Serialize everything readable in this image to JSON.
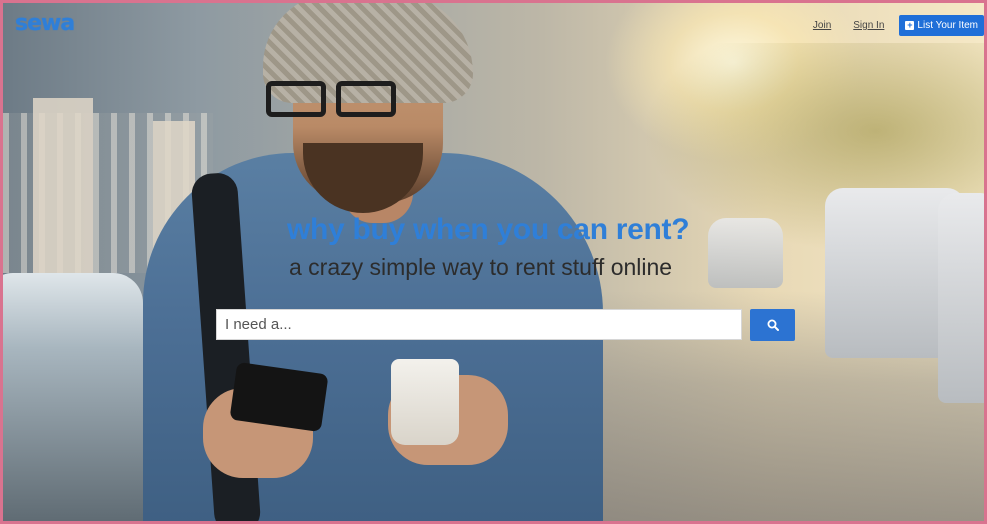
{
  "brand": {
    "logo_text": "sewa"
  },
  "nav": {
    "join": "Join",
    "sign_in": "Sign In",
    "list_item": "List Your Item",
    "list_item_icon": "plus-square-icon"
  },
  "hero": {
    "headline": "why buy when you can rent?",
    "subline": "a crazy simple way to rent stuff online"
  },
  "search": {
    "placeholder": "I need a...",
    "value": "",
    "button_icon": "search-icon"
  },
  "colors": {
    "accent": "#2f7fd8",
    "button_blue": "#1f6fd8",
    "border": "#d9738f"
  }
}
